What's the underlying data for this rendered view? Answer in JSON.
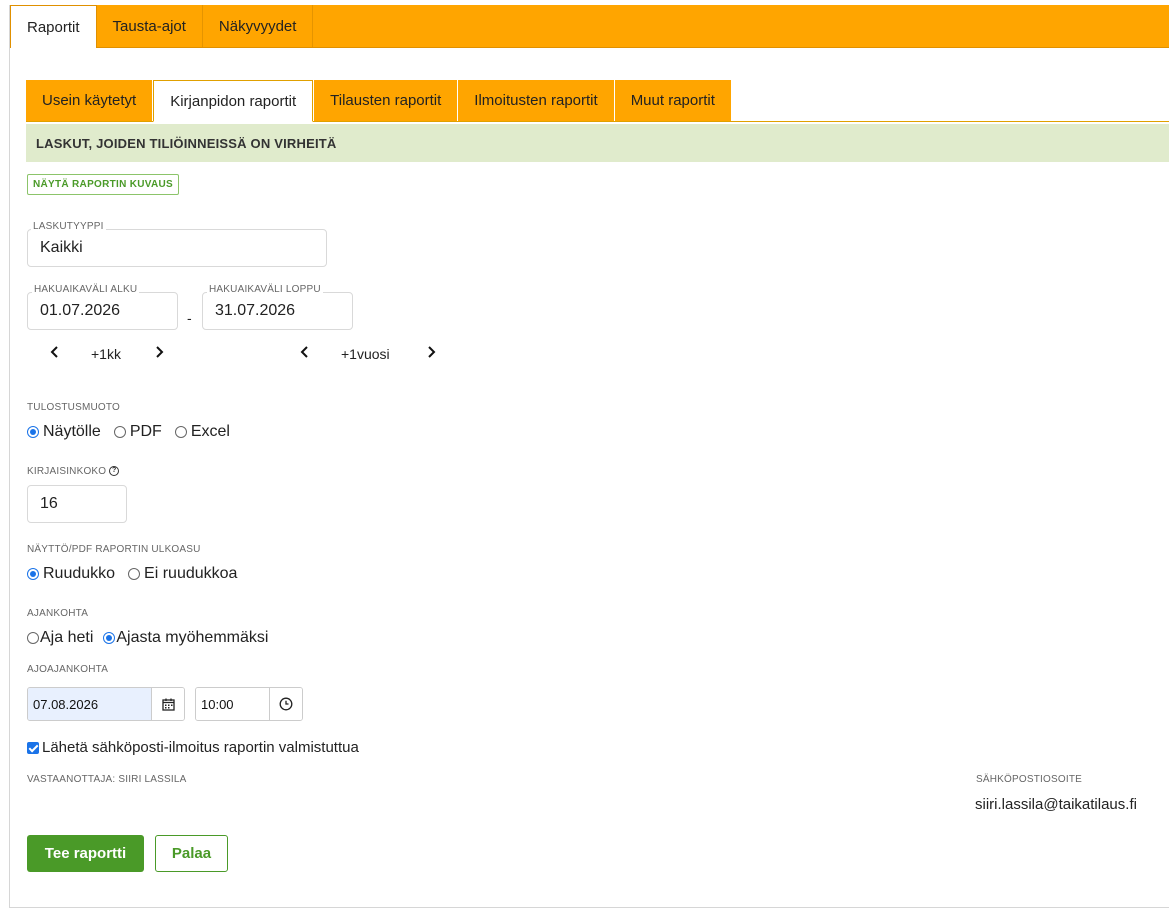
{
  "top_tabs": [
    "Raportit",
    "Tausta-ajot",
    "Näkyvyydet"
  ],
  "sub_tabs": [
    "Usein käytetyt",
    "Kirjanpidon raportit",
    "Tilausten raportit",
    "Ilmoitusten raportit",
    "Muut raportit"
  ],
  "report_title": "LASKUT, JOIDEN TILIÖINNEISSÄ ON VIRHEITÄ",
  "show_description": "NÄYTÄ RAPORTIN KUVAUS",
  "invoice_type": {
    "label": "LASKUTYYPPI",
    "value": "Kaikki"
  },
  "period_start": {
    "label": "HAKUAIKAVÄLI ALKU",
    "value": "01.07.2026"
  },
  "period_separator": "-",
  "period_end": {
    "label": "HAKUAIKAVÄLI LOPPU",
    "value": "31.07.2026"
  },
  "month_nav": {
    "prev": "‹",
    "label": "+1kk",
    "next": "›"
  },
  "year_nav": {
    "prev": "‹",
    "label": "+1vuosi",
    "next": "›"
  },
  "output_format": {
    "label": "TULOSTUSMUOTO",
    "options": [
      "Näytölle",
      "PDF",
      "Excel"
    ],
    "selected": "Näytölle"
  },
  "font_size": {
    "label": "KIRJAISINKOKO",
    "help": "?",
    "value": "16"
  },
  "layout": {
    "label": "NÄYTTÖ/PDF RAPORTIN ULKOASU",
    "options": [
      "Ruudukko",
      "Ei ruudukkoa"
    ],
    "selected": "Ruudukko"
  },
  "timing": {
    "label": "AJANKOHTA",
    "options": [
      "Aja heti",
      "Ajasta myöhemmäksi"
    ],
    "selected": "Ajasta myöhemmäksi"
  },
  "run_time": {
    "label": "AJOAJANKOHTA",
    "date": "07.08.2026",
    "time": "10:00"
  },
  "email_notify": {
    "label": "Lähetä sähköposti-ilmoitus raportin valmistuttua",
    "checked": true
  },
  "recipient_label": "VASTAANOTTAJA: SIIRI LASSILA",
  "email": {
    "label": "SÄHKÖPOSTIOSOITE",
    "value": "siiri.lassila@taikatilaus.fi"
  },
  "buttons": {
    "submit": "Tee raportti",
    "back": "Palaa"
  },
  "colors": {
    "accent": "#ffa500",
    "primary": "#4a9a28",
    "header_bg": "#e0ebcc",
    "radio": "#1a73e8"
  }
}
